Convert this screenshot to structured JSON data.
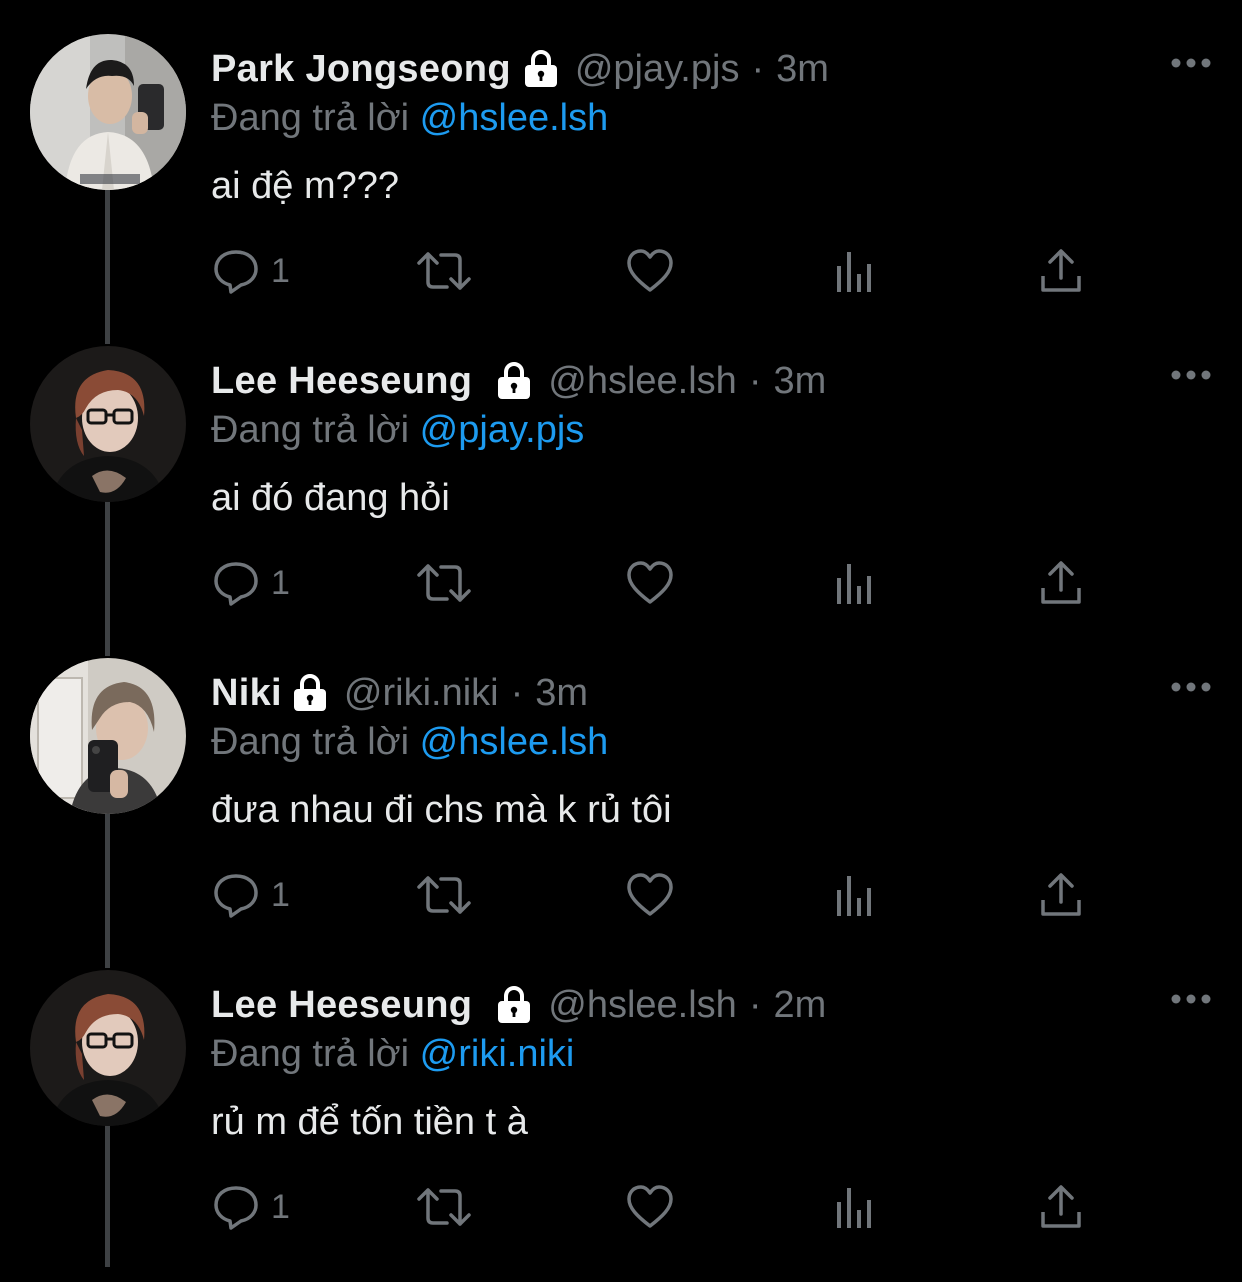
{
  "theme": {
    "background": "#000000",
    "text": "#e7e9ea",
    "muted": "#71767b",
    "accent": "#1d9bf0",
    "thread_line": "#3e4144"
  },
  "tweets": [
    {
      "name": "Park Jongseong",
      "handle": "@pjay.pjs",
      "separator": "·",
      "time": "3m",
      "reply_label": "Đang trả lời",
      "reply_to": "@hslee.lsh",
      "text": "ai đệ m???",
      "reply_count": "1",
      "avatar": "avatar-photo-park-jongseong"
    },
    {
      "name": "Lee Heeseung",
      "handle": "@hslee.lsh",
      "separator": "·",
      "time": "3m",
      "reply_label": "Đang trả lời",
      "reply_to": "@pjay.pjs",
      "text": "ai đó đang hỏi",
      "reply_count": "1",
      "avatar": "avatar-photo-lee-heeseung"
    },
    {
      "name": "Niki",
      "handle": "@riki.niki",
      "separator": "·",
      "time": "3m",
      "reply_label": "Đang trả lời",
      "reply_to": "@hslee.lsh",
      "text": "đưa nhau đi chs mà k rủ tôi",
      "reply_count": "1",
      "avatar": "avatar-photo-niki"
    },
    {
      "name": "Lee Heeseung",
      "handle": "@hslee.lsh",
      "separator": "·",
      "time": "2m",
      "reply_label": "Đang trả lời",
      "reply_to": "@riki.niki",
      "text": "rủ m để tốn tiền t à",
      "reply_count": "1",
      "avatar": "avatar-photo-lee-heeseung"
    }
  ],
  "icons": {
    "lock": "lock-icon",
    "more": "more-icon",
    "reply": "reply-icon",
    "retweet": "retweet-icon",
    "like": "like-icon",
    "views": "views-icon",
    "share": "share-icon"
  }
}
